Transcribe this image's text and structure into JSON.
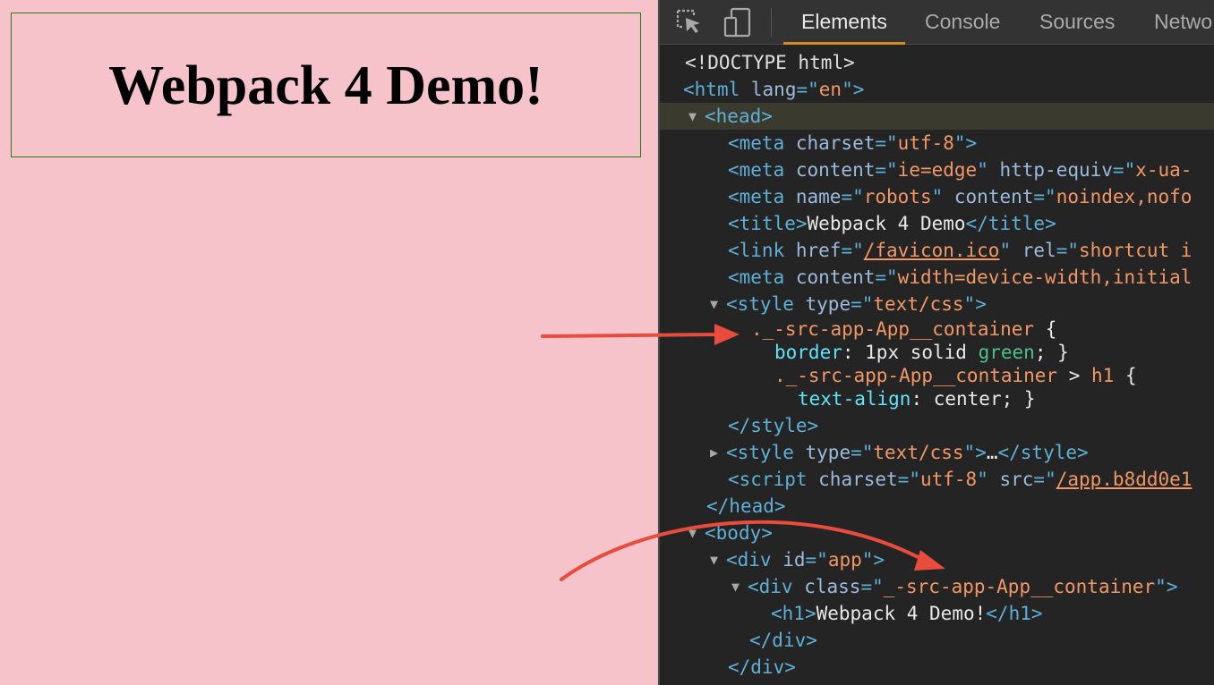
{
  "viewport": {
    "heading": "Webpack 4 Demo!",
    "background_color": "#f7c3cb",
    "container_border_color": "#2f7a18"
  },
  "devtools": {
    "toolbar": {
      "inspect_icon": "cursor-select-icon",
      "device_icon": "device-toggle-icon",
      "tabs": [
        "Elements",
        "Console",
        "Sources",
        "Netwo"
      ],
      "active_tab": "Elements"
    },
    "tree": {
      "doctype": "<!DOCTYPE html>",
      "html": {
        "tag": "html",
        "attr": "lang",
        "val": "en"
      },
      "head": "head",
      "meta1": {
        "attr": "charset",
        "val": "utf-8"
      },
      "meta2": {
        "attr1": "content",
        "val1": "ie=edge",
        "attr2": "http-equiv",
        "val2": "x-ua-"
      },
      "meta3": {
        "attr1": "name",
        "val1": "robots",
        "attr2": "content",
        "val2": "noindex,nofo"
      },
      "title": {
        "open": "title",
        "text": "Webpack 4 Demo",
        "close": "title"
      },
      "link": {
        "attr1": "href",
        "val1": "/favicon.ico",
        "attr2": "rel",
        "val2": "shortcut i"
      },
      "meta4": {
        "attr": "content",
        "val": "width=device-width,initial"
      },
      "style1": {
        "attr": "type",
        "val": "text/css"
      },
      "css": {
        "sel1": "._-src-app-App__container",
        "prop1": "border",
        "val1a": "1px solid ",
        "val1b": "green",
        "sel2": "._-src-app-App__container",
        "child": "h1",
        "prop2": "text-align",
        "val2": "center"
      },
      "style_close": "style",
      "style2": {
        "attr": "type",
        "val": "text/css",
        "ellipsis": "…"
      },
      "script": {
        "attr1": "charset",
        "val1": "utf-8",
        "attr2": "src",
        "val2": "/app.b8dd0e1"
      },
      "head_close": "head",
      "body": "body",
      "div_app": {
        "attr": "id",
        "val": "app"
      },
      "div_container": {
        "attr": "class",
        "val": "_-src-app-App__container"
      },
      "h1": {
        "open": "h1",
        "text": "Webpack 4 Demo!",
        "close": "h1"
      },
      "div_close1": "div",
      "div_close2": "div"
    }
  },
  "annotations": {
    "arrow_color": "#e84c3d",
    "arrow_count": 2
  }
}
